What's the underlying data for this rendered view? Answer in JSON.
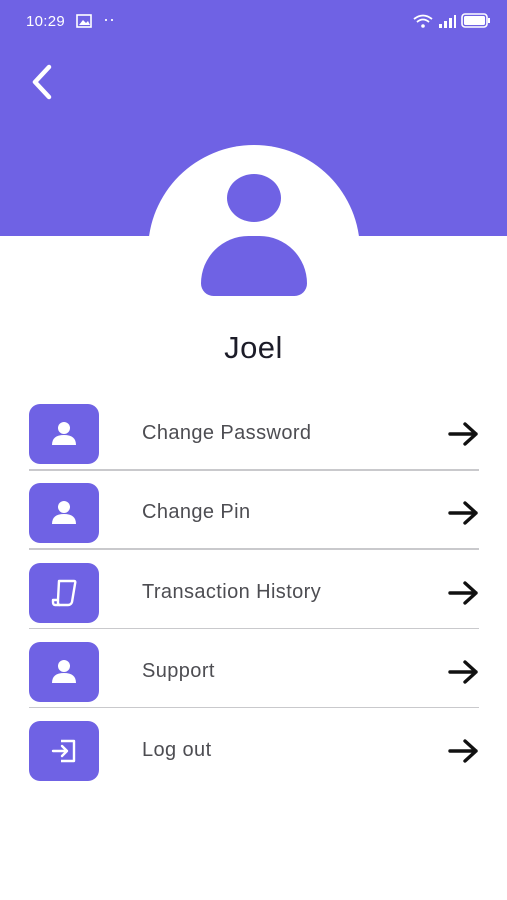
{
  "status_bar": {
    "time": "10:29",
    "left_icons": [
      "gallery-icon",
      "dots-icon"
    ],
    "right_icons": [
      "wifi-icon",
      "signal-icon",
      "battery-icon"
    ]
  },
  "header": {
    "back_icon": "chevron-left-icon",
    "color": "#6f62e4"
  },
  "profile": {
    "avatar_icon": "user-avatar-icon",
    "name": "Joel"
  },
  "menu": {
    "items": [
      {
        "label": "Change Password",
        "icon": "user-icon"
      },
      {
        "label": "Change Pin",
        "icon": "user-icon"
      },
      {
        "label": "Transaction History",
        "icon": "scroll-icon"
      },
      {
        "label": "Support",
        "icon": "user-icon"
      },
      {
        "label": "Log out",
        "icon": "login-icon"
      }
    ],
    "arrow_icon": "arrow-right-icon"
  }
}
